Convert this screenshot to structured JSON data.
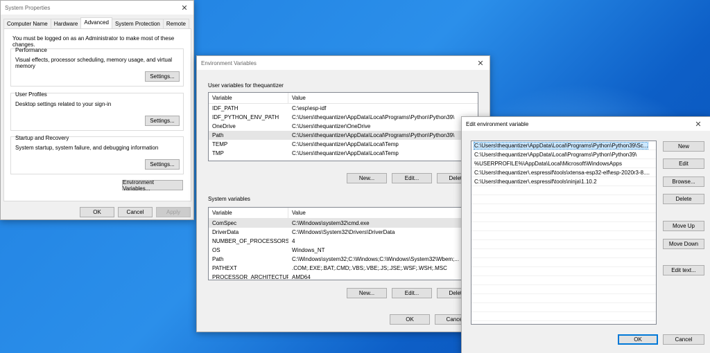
{
  "system_properties": {
    "title": "System Properties",
    "tabs": [
      "Computer Name",
      "Hardware",
      "Advanced",
      "System Protection",
      "Remote"
    ],
    "active_tab": "Advanced",
    "admin_notice": "You must be logged on as an Administrator to make most of these changes.",
    "performance": {
      "title": "Performance",
      "desc": "Visual effects, processor scheduling, memory usage, and virtual memory",
      "button": "Settings..."
    },
    "user_profiles": {
      "title": "User Profiles",
      "desc": "Desktop settings related to your sign-in",
      "button": "Settings..."
    },
    "startup_recovery": {
      "title": "Startup and Recovery",
      "desc": "System startup, system failure, and debugging information",
      "button": "Settings..."
    },
    "env_button": "Environment Variables...",
    "ok": "OK",
    "cancel": "Cancel",
    "apply": "Apply"
  },
  "env_vars": {
    "title": "Environment Variables",
    "user_section": "User variables for thequantizer",
    "col_variable": "Variable",
    "col_value": "Value",
    "user_rows": [
      {
        "variable": "IDF_PATH",
        "value": "C:\\esp\\esp-idf"
      },
      {
        "variable": "IDF_PYTHON_ENV_PATH",
        "value": "C:\\Users\\thequantizer\\AppData\\Local\\Programs\\Python\\Python39\\"
      },
      {
        "variable": "OneDrive",
        "value": "C:\\Users\\thequantizer\\OneDrive"
      },
      {
        "variable": "Path",
        "value": "C:\\Users\\thequantizer\\AppData\\Local\\Programs\\Python\\Python39\\"
      },
      {
        "variable": "TEMP",
        "value": "C:\\Users\\thequantizer\\AppData\\Local\\Temp"
      },
      {
        "variable": "TMP",
        "value": "C:\\Users\\thequantizer\\AppData\\Local\\Temp"
      }
    ],
    "user_new": "New...",
    "user_edit": "Edit...",
    "user_delete": "Delete",
    "system_section": "System variables",
    "system_rows": [
      {
        "variable": "ComSpec",
        "value": "C:\\Windows\\system32\\cmd.exe"
      },
      {
        "variable": "DriverData",
        "value": "C:\\Windows\\System32\\Drivers\\DriverData"
      },
      {
        "variable": "NUMBER_OF_PROCESSORS",
        "value": "4"
      },
      {
        "variable": "OS",
        "value": "Windows_NT"
      },
      {
        "variable": "Path",
        "value": "C:\\Windows\\system32;C:\\Windows;C:\\Windows\\System32\\Wbem;..."
      },
      {
        "variable": "PATHEXT",
        "value": ".COM;.EXE;.BAT;.CMD;.VBS;.VBE;.JS;.JSE;.WSF;.WSH;.MSC"
      },
      {
        "variable": "PROCESSOR_ARCHITECTURE",
        "value": "AMD64"
      }
    ],
    "sys_new": "New...",
    "sys_edit": "Edit...",
    "sys_delete": "Delete",
    "ok": "OK",
    "cancel": "Cancel"
  },
  "edit_env": {
    "title": "Edit environment variable",
    "entries": [
      "C:\\Users\\thequantizer\\AppData\\Local\\Programs\\Python\\Python39\\Sc...",
      "C:\\Users\\thequantizer\\AppData\\Local\\Programs\\Python\\Python39\\",
      "%USERPROFILE%\\AppData\\Local\\Microsoft\\WindowsApps",
      "C:\\Users\\thequantizer\\.espressif\\tools\\xtensa-esp32-elf\\esp-2020r3-8....",
      "C:\\Users\\thequantizer\\.espressif\\tools\\ninja\\1.10.2"
    ],
    "buttons": {
      "new": "New",
      "edit": "Edit",
      "browse": "Browse...",
      "delete": "Delete",
      "move_up": "Move Up",
      "move_down": "Move Down",
      "edit_text": "Edit text..."
    },
    "ok": "OK",
    "cancel": "Cancel"
  },
  "close_glyph": "✕"
}
